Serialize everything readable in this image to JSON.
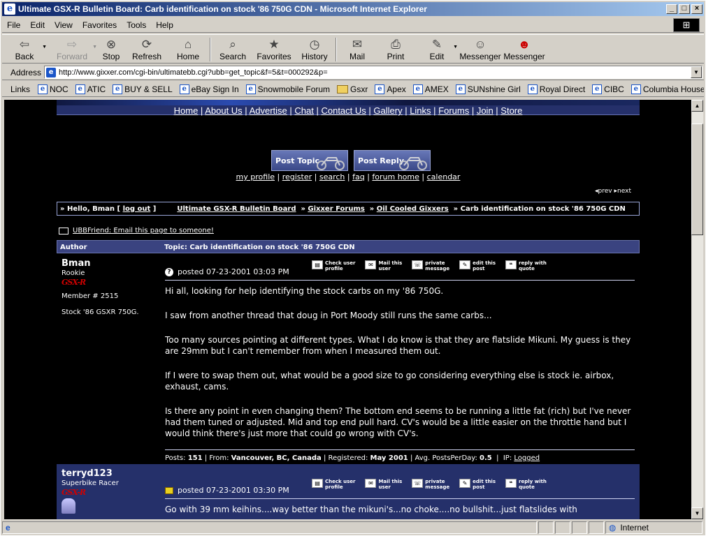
{
  "window": {
    "title": "Ultimate GSX-R Bulletin Board: Carb identification on stock '86 750G CDN - Microsoft Internet Explorer"
  },
  "menu": [
    "File",
    "Edit",
    "View",
    "Favorites",
    "Tools",
    "Help"
  ],
  "toolbar": {
    "back": "Back",
    "forward": "Forward",
    "stop": "Stop",
    "refresh": "Refresh",
    "home": "Home",
    "search": "Search",
    "favorites": "Favorites",
    "history": "History",
    "mail": "Mail",
    "print": "Print",
    "edit": "Edit",
    "messenger1": "Messenger",
    "messenger2": "Messenger"
  },
  "address": {
    "label": "Address",
    "url": "http://www.gixxer.com/cgi-bin/ultimatebb.cgi?ubb=get_topic&f=5&t=000292&p="
  },
  "links": {
    "label": "Links",
    "items": [
      "NOC",
      "ATIC",
      "BUY & SELL",
      "eBay Sign In",
      "Snowmobile Forum",
      "Gsxr",
      "Apex",
      "AMEX",
      "SUNshine Girl",
      "Royal Direct",
      "CIBC",
      "Columbia House"
    ]
  },
  "status": {
    "zone": "Internet"
  },
  "nav": [
    "Home",
    "About Us",
    "Advertise",
    "Chat",
    "Contact Us",
    "Gallery",
    "Links",
    "Forums",
    "Join",
    "Store"
  ],
  "buttons": {
    "post_topic": "Post Topic",
    "post_reply": "Post Reply"
  },
  "toplinks": [
    "my profile",
    "register",
    "search",
    "faq",
    "forum home",
    "calendar"
  ],
  "prevnext": {
    "prev": "prev",
    "next": "next"
  },
  "breadcrumb": {
    "hello": "Hello, Bman",
    "logout": "log out",
    "board": "Ultimate GSX-R Bulletin Board",
    "forum": "Gixxer Forums",
    "sub": "Oil Cooled Gixxers",
    "topic": "Carb identification on stock '86 750G CDN"
  },
  "email_link": "UBBFriend: Email this page to someone!",
  "thread": {
    "author_col": "Author",
    "topic_label": "Topic: Carb identification on stock '86 750G CDN"
  },
  "actions": [
    [
      "Check user",
      "profile"
    ],
    [
      "Mail this",
      "user"
    ],
    [
      "private",
      "message"
    ],
    [
      "edit this",
      "post"
    ],
    [
      "reply with",
      "quote"
    ]
  ],
  "post1": {
    "username": "Bman",
    "rank": "Rookie",
    "member": "Member # 2515",
    "note": "Stock '86 GSXR 750G.",
    "posted": "posted 07-23-2001 03:03 PM",
    "paragraphs": [
      "Hi all, looking for help identifying the stock carbs on my '86 750G.",
      "I saw from another thread that doug in Port Moody still runs the same carbs...",
      "Too many sources pointing at different types. What I do know is that they are flatslide Mikuni. My guess is they are 29mm but I can't remember from when I measured them out.",
      "If I were to swap them out, what would be a good size to go considering everything else is stock ie. airbox, exhaust, cams.",
      "Is there any point in even changing them? The bottom end seems to be running a little fat (rich) but I've never had them tuned or adjusted. Mid and top end pull hard. CV's would be a little easier on the throttle hand but I would think there's just more that could go wrong with CV's."
    ],
    "foot": {
      "posts_label": "Posts:",
      "posts": "151",
      "from_label": "From:",
      "from": "Vancouver, BC, Canada",
      "reg_label": "Registered:",
      "reg": "May 2001",
      "avg_label": "Avg. PostsPerDay:",
      "avg": "0.5",
      "ip_label": "IP:",
      "ip": "Logged"
    }
  },
  "post2": {
    "username": "terryd123",
    "rank": "Superbike Racer",
    "posted": "posted 07-23-2001 03:30 PM",
    "paragraph": "Go with 39 mm keihins....way better than the mikuni's...no choke....no bullshit...just flatslides with"
  }
}
